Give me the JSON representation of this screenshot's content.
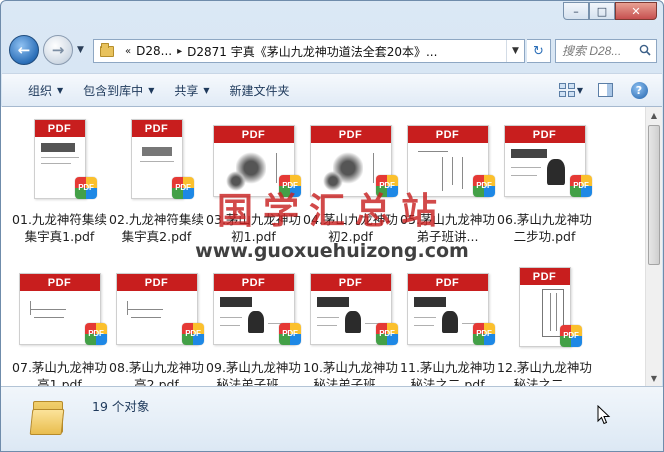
{
  "window": {
    "caption_buttons": [
      "–",
      "□",
      "✕"
    ]
  },
  "address": {
    "breadcrumb": [
      "D28...",
      "D2871 宇真《茅山九龙神功道法全套20本》..."
    ],
    "chevron": "«",
    "search_placeholder": "搜索 D28..."
  },
  "toolbar": {
    "organize": "组织",
    "include_library": "包含到库中",
    "share": "共享",
    "new_folder": "新建文件夹"
  },
  "files": [
    {
      "name": "01.九龙神符集续集宇真1.pdf",
      "thumb": "portrait",
      "style": "title"
    },
    {
      "name": "02.九龙神符集续集宇真2.pdf",
      "thumb": "portrait",
      "style": "title-blank"
    },
    {
      "name": "03.茅山九龙神功初1.pdf",
      "thumb": "landscape",
      "style": "ink"
    },
    {
      "name": "04.茅山九龙神功初2.pdf",
      "thumb": "landscape",
      "style": "ink"
    },
    {
      "name": "05.茅山九龙神功弟子班讲...",
      "thumb": "landscape",
      "style": "vertical"
    },
    {
      "name": "06.茅山九龙神功二步功.pdf",
      "thumb": "landscape",
      "style": "photo"
    },
    {
      "name": "07.茅山九龙神功高1.pdf",
      "thumb": "landscape",
      "style": "handwrite"
    },
    {
      "name": "08.茅山九龙神功高2.pdf",
      "thumb": "landscape",
      "style": "handwrite"
    },
    {
      "name": "09.茅山九龙神功秘法弟子班...",
      "thumb": "landscape",
      "style": "photo2"
    },
    {
      "name": "10.茅山九龙神功秘法弟子班...",
      "thumb": "landscape",
      "style": "photo2"
    },
    {
      "name": "11.茅山九龙神功秘法之二.pdf",
      "thumb": "landscape",
      "style": "photo2"
    },
    {
      "name": "12.茅山九龙神功秘法之二...",
      "thumb": "portrait",
      "style": "box"
    }
  ],
  "pdf_label": "PDF",
  "badge_text": "PDF",
  "watermark": {
    "title": "国学汇总站",
    "url": "www.guoxuehuizong.com"
  },
  "status": {
    "count": "19 个对象"
  },
  "colors": {
    "pdf_red": "#c81e1e",
    "chrome_blue": "#dbe8f5",
    "watermark_red": "#c82222"
  }
}
